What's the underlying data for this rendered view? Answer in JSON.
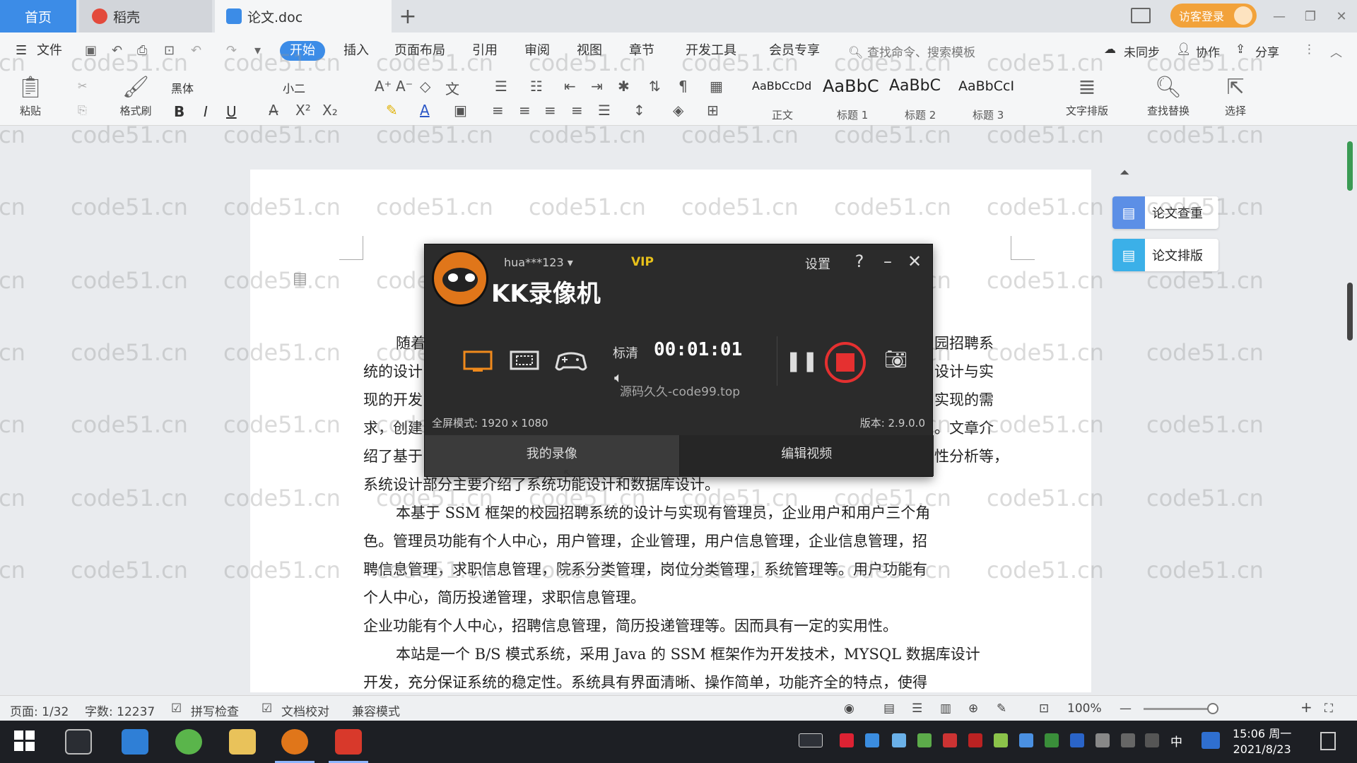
{
  "tabs": {
    "home": "首页",
    "daoke": "稻壳",
    "doc": "论文.doc",
    "add": "+"
  },
  "titlebar": {
    "login": "访客登录"
  },
  "menu": {
    "file": "文件",
    "items": [
      "开始",
      "插入",
      "页面布局",
      "引用",
      "审阅",
      "视图",
      "章节",
      "开发工具",
      "会员专享"
    ],
    "search": "查找命令、搜索模板",
    "sync": "未同步",
    "collab": "协作",
    "share": "分享"
  },
  "ribbon": {
    "paste": "粘贴",
    "format_painter": "格式刷",
    "font": "黑体",
    "size": "小二",
    "bold": "B",
    "italic": "I",
    "underline": "U",
    "styles": [
      {
        "preview": "AaBbCcDd",
        "label": "正文"
      },
      {
        "preview": "AaBbC",
        "label": "标题 1"
      },
      {
        "preview": "AaBbC",
        "label": "标题 2"
      },
      {
        "preview": "AaBbCcI",
        "label": "标题 3"
      }
    ],
    "text_tools": "文字排版",
    "find_replace": "查找替换",
    "select": "选择"
  },
  "side": {
    "check": "论文查重",
    "layout": "论文排版"
  },
  "document": {
    "lines": [
      "随着",
      "统的设计",
      "现的开发",
      "求，创建",
      "绍了基于",
      "系统设计部分主要介绍了系统功能设计和数据库设计。",
      "本基于 SSM 框架的校园招聘系统的设计与实现有管理员，企业用户和用户三个角",
      "色。管理员功能有个人中心，用户管理，企业管理，用户信息管理，企业信息管理，招",
      "聘信息管理，求职信息管理，院系分类管理，岗位分类管理，系统管理等。用户功能有",
      "个人中心，简历投递管理，求职信息管理。",
      "企业功能有个人中心，招聘信息管理，简历投递管理等。因而具有一定的实用性。",
      "本站是一个 B/S 模式系统，采用 Java 的 SSM 框架作为开发技术，MYSQL 数据库设计",
      "开发，充分保证系统的稳定性。系统具有界面清晰、操作简单，功能齐全的特点，使得"
    ],
    "right_fragments": [
      "园招聘系",
      "设计与实",
      "实现的需",
      "。文章介",
      "性分析等，"
    ]
  },
  "watermark": "code51.cn",
  "recorder": {
    "title": "KK录像机",
    "user": "hua***123",
    "vip": "VIP",
    "settings": "设置",
    "help": "?",
    "minimize": "–",
    "close": "✕",
    "quality": "标清",
    "timer": "00:01:01",
    "overlay": "源码久久-code99.top",
    "mode": "全屏模式: 1920 x 1080",
    "version": "版本: 2.9.0.0",
    "tab_mine": "我的录像",
    "tab_edit": "编辑视频"
  },
  "status": {
    "page": "页面: 1/32",
    "words": "字数: 12237",
    "spell": "拼写检查",
    "proof": "文档校对",
    "compat": "兼容模式",
    "zoom": "100%"
  },
  "clock": {
    "time": "15:06 周一",
    "date": "2021/8/23"
  },
  "colors": {
    "accent": "#3c8ce7",
    "record": "#e53030",
    "vip": "#e7c01a"
  }
}
